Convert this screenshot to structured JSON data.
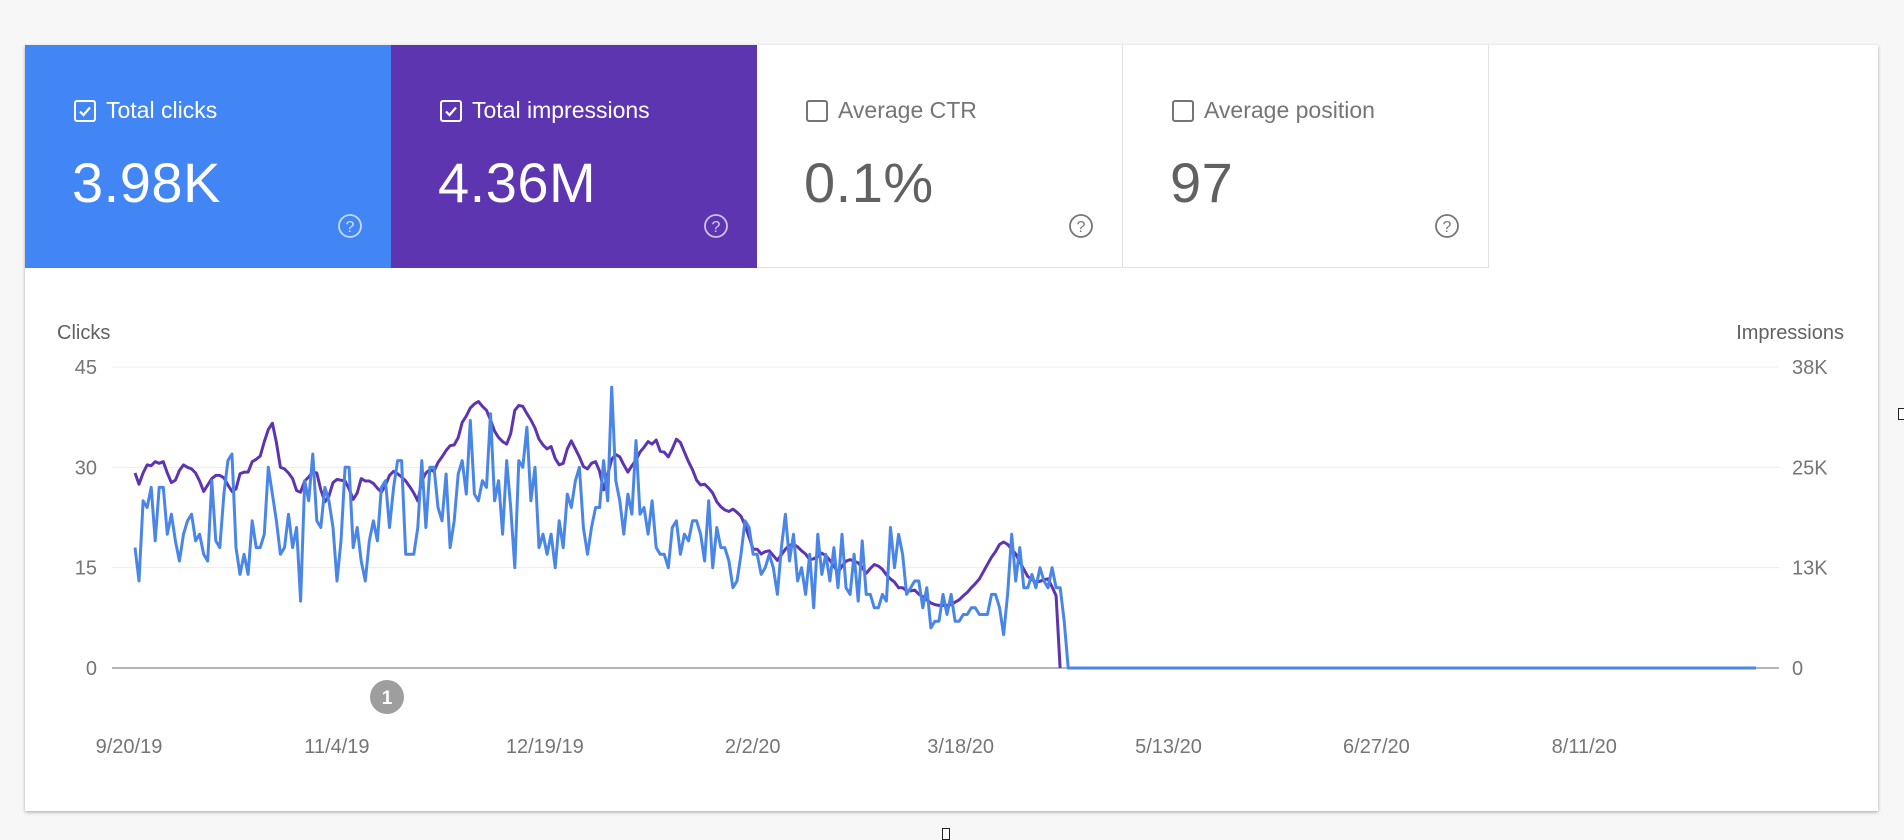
{
  "cards": [
    {
      "id": "clicks",
      "label": "Total clicks",
      "value": "3.98K",
      "checked": true,
      "color": "#4285f4"
    },
    {
      "id": "impressions",
      "label": "Total impressions",
      "value": "4.36M",
      "checked": true,
      "color": "#5e35b1"
    },
    {
      "id": "ctr",
      "label": "Average CTR",
      "value": "0.1%",
      "checked": false
    },
    {
      "id": "position",
      "label": "Average position",
      "value": "97",
      "checked": false
    }
  ],
  "help_icon": "help-circle-icon",
  "chart_data": {
    "type": "line",
    "title": "",
    "left_axis": {
      "label": "Clicks",
      "ticks": [
        "45",
        "30",
        "15",
        "0"
      ],
      "range": [
        0,
        45
      ]
    },
    "right_axis": {
      "label": "Impressions",
      "ticks": [
        "38K",
        "25K",
        "13K",
        "0"
      ],
      "range": [
        0,
        37500
      ]
    },
    "x_tick_labels": [
      "9/20/19",
      "11/4/19",
      "12/19/19",
      "2/2/20",
      "3/18/20",
      "5/13/20",
      "6/27/20",
      "8/11/20"
    ],
    "x_start_date": "9/21/19",
    "x_days": 353,
    "grid": true,
    "annotation": {
      "label": "1",
      "date": "11/12/19"
    },
    "series": [
      {
        "name": "Clicks",
        "axis": "left",
        "color": "#4a86e8",
        "values": [
          18,
          13,
          25,
          24,
          27,
          19,
          27,
          27,
          20,
          23,
          19,
          16,
          20,
          22,
          23,
          19,
          20,
          17,
          16,
          28,
          19,
          18,
          26,
          31,
          32,
          18,
          14,
          17,
          14,
          22,
          18,
          18,
          20,
          30,
          26,
          22,
          17,
          18,
          23,
          18,
          21,
          10,
          28,
          25,
          32,
          22,
          21,
          27,
          25,
          21,
          13,
          19,
          30,
          30,
          18,
          21,
          16,
          13,
          19,
          22,
          19,
          27,
          28,
          21,
          27,
          31,
          31,
          17,
          17,
          17,
          21,
          31,
          21,
          30,
          30,
          24,
          22,
          29,
          18,
          22,
          29,
          31,
          26,
          37,
          26,
          25,
          28,
          27,
          38,
          25,
          28,
          20,
          31,
          24,
          15,
          31,
          30,
          36,
          25,
          30,
          18,
          20,
          17,
          20,
          15,
          22,
          18,
          26,
          24,
          28,
          30,
          21,
          17,
          21,
          24,
          24,
          31,
          25,
          42,
          28,
          25,
          20,
          26,
          23,
          34,
          23,
          24,
          20,
          25,
          18,
          17,
          17,
          15,
          21,
          22,
          17,
          20,
          19,
          22,
          22,
          20,
          16,
          25,
          15,
          21,
          18,
          18,
          16,
          12,
          13,
          17,
          22,
          21,
          17,
          17,
          14,
          15,
          17,
          15,
          11,
          18,
          23,
          16,
          20,
          13,
          15,
          11,
          17,
          9,
          20,
          14,
          17,
          13,
          18,
          12,
          20,
          12,
          11,
          17,
          10,
          19,
          11,
          11,
          9,
          9,
          11,
          10,
          21,
          15,
          20,
          17,
          11,
          12,
          13,
          13,
          9,
          12,
          6,
          7,
          7,
          11,
          8,
          11,
          7,
          7,
          8,
          8,
          9,
          9,
          8,
          8,
          8,
          11,
          11,
          9,
          5,
          11,
          20,
          13,
          18,
          12,
          12,
          14,
          12,
          15,
          13,
          12,
          15,
          12,
          12,
          7
        ],
        "zero_after_index": 230
      },
      {
        "name": "Impressions",
        "axis": "right",
        "color": "#5e35b1",
        "values": [
          24300,
          22900,
          24300,
          25300,
          25200,
          25700,
          25500,
          25700,
          24300,
          23100,
          23400,
          24600,
          25300,
          25000,
          24800,
          24300,
          23300,
          22000,
          22800,
          23600,
          24000,
          24000,
          23700,
          22800,
          22000,
          22300,
          24200,
          24400,
          24400,
          25700,
          26000,
          26400,
          28200,
          29700,
          30500,
          28100,
          25000,
          24800,
          24300,
          23600,
          22100,
          21900,
          23300,
          23800,
          24400,
          24300,
          22200,
          20700,
          21400,
          23100,
          23500,
          23400,
          23300,
          22300,
          21000,
          21800,
          23600,
          23300,
          23300,
          23000,
          22400,
          21900,
          22800,
          24000,
          24500,
          24200,
          23800,
          23300,
          22600,
          21800,
          20800,
          23300,
          24300,
          24700,
          24500,
          25600,
          26300,
          27100,
          27700,
          27800,
          28700,
          30600,
          31400,
          32400,
          32900,
          33200,
          32600,
          32100,
          30900,
          29500,
          28700,
          28200,
          27900,
          29200,
          32100,
          32700,
          32600,
          31700,
          30900,
          29900,
          28500,
          27800,
          27300,
          27600,
          26100,
          25300,
          25500,
          27300,
          28300,
          27300,
          26300,
          25100,
          24800,
          25500,
          25700,
          24500,
          22200,
          24100,
          26000,
          26600,
          26300,
          25300,
          24400,
          25200,
          25900,
          26900,
          27500,
          28200,
          27900,
          28400,
          27000,
          26900,
          26300,
          27300,
          28500,
          28100,
          26900,
          25700,
          24700,
          23400,
          22800,
          22900,
          22400,
          21800,
          20700,
          20100,
          19700,
          19500,
          19800,
          19400,
          18900,
          17800,
          16300,
          14800,
          14800,
          14200,
          14500,
          14600,
          14000,
          13400,
          14100,
          14800,
          15300,
          15400,
          15100,
          14600,
          14200,
          13500,
          13600,
          13900,
          14300,
          14000,
          13400,
          12700,
          11900,
          12700,
          13300,
          13500,
          13300,
          13100,
          12500,
          11800,
          12400,
          12900,
          12700,
          12300,
          11600,
          11100,
          10700,
          10000,
          10000,
          9600,
          9600,
          9700,
          9200,
          8900,
          8500,
          8100,
          7900,
          7800,
          7800,
          7800,
          7900,
          8200,
          8500,
          9000,
          9400,
          10000,
          10500,
          11100,
          12000,
          12900,
          13800,
          14500,
          15400,
          15700,
          15400,
          14800,
          14200,
          13200,
          12300,
          11400,
          11000,
          10700,
          10800,
          11000,
          11100,
          10100,
          9000
        ],
        "zero_after_index": 230
      }
    ]
  }
}
